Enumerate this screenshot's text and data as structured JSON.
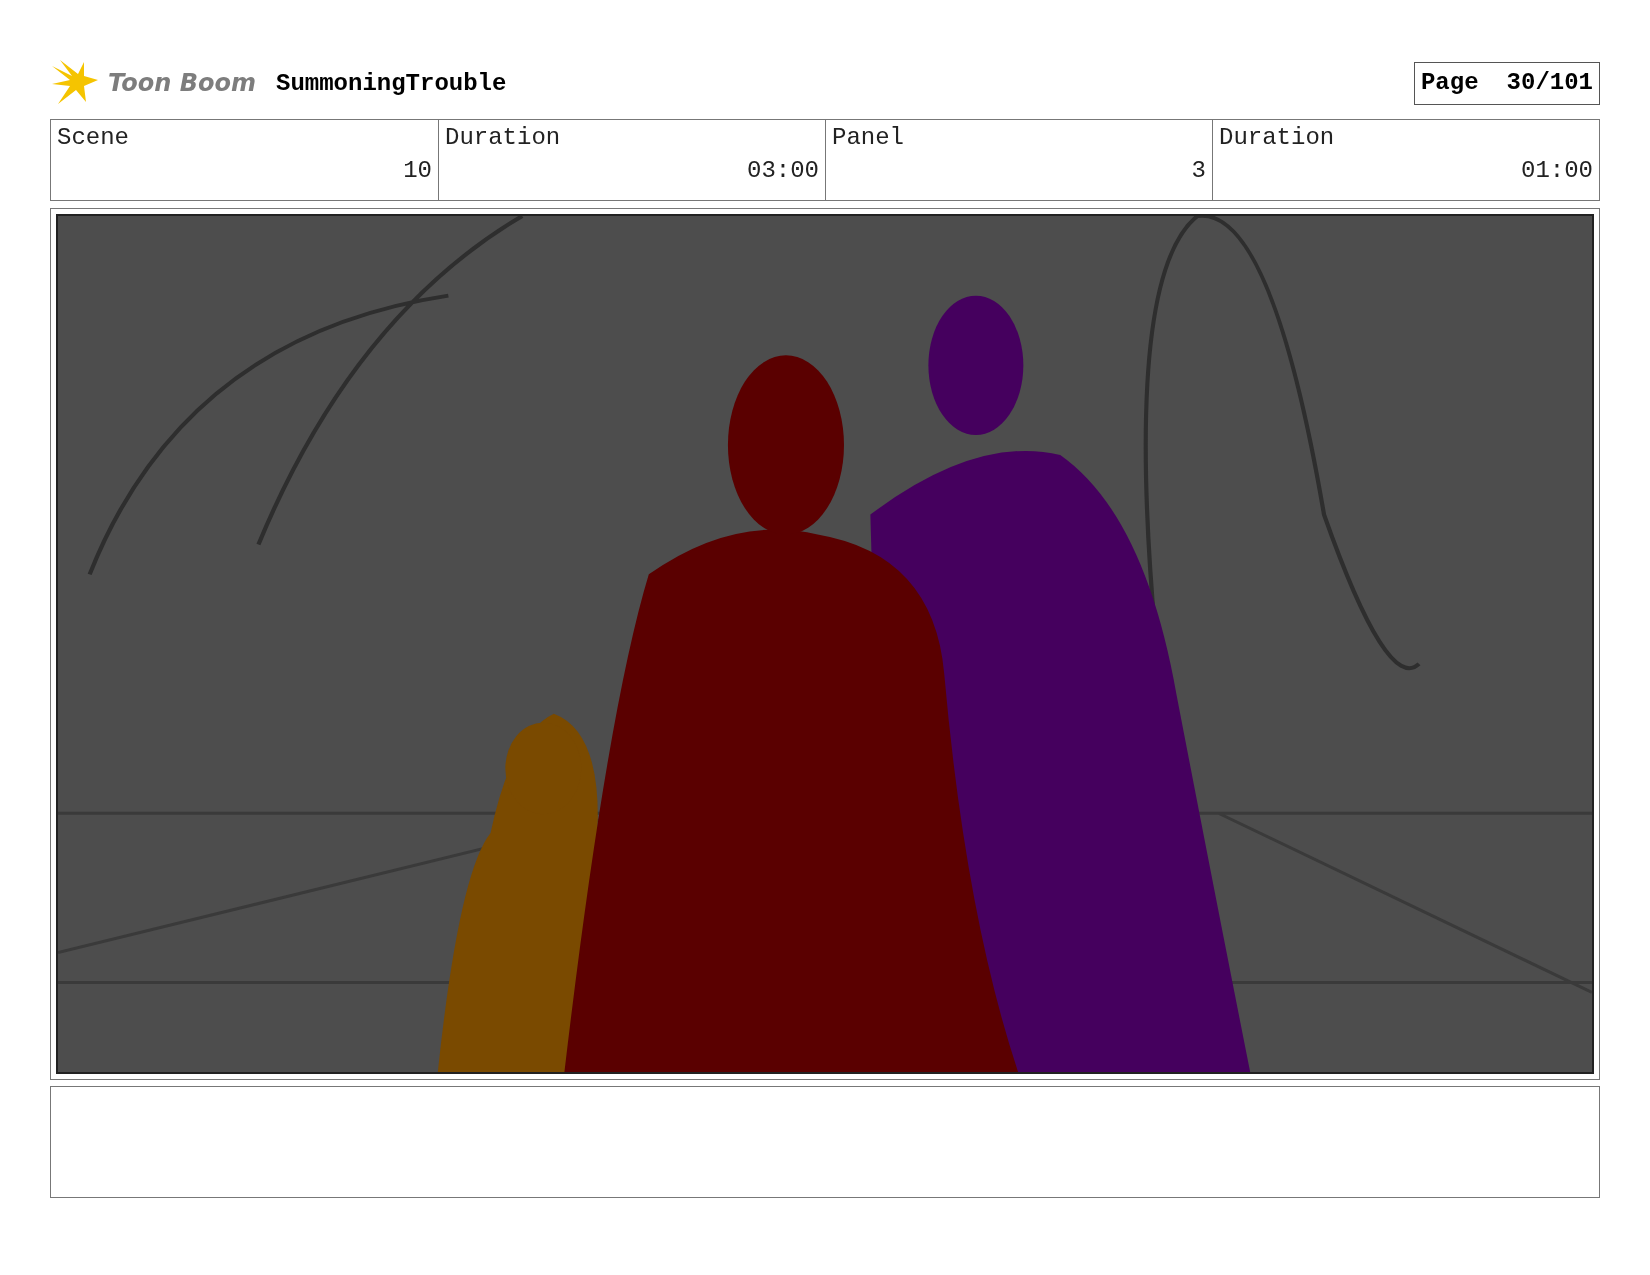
{
  "header": {
    "logo": "Toon Boom",
    "project": "SummoningTrouble",
    "page_label": "Page",
    "page": "30/101"
  },
  "info_table": {
    "columns": [
      "Scene",
      "Duration",
      "Panel",
      "Duration"
    ],
    "row": [
      "10",
      "03:00",
      "3",
      "01:00"
    ]
  }
}
